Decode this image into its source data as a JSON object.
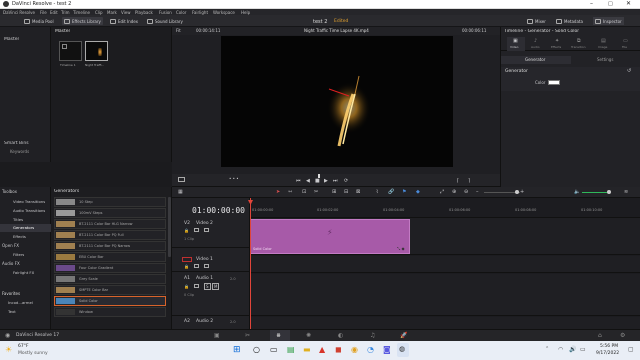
{
  "window": {
    "title": "DaVinci Resolve - test 2"
  },
  "menu": [
    "DaVinci Resolve",
    "File",
    "Edit",
    "Trim",
    "Timeline",
    "Clip",
    "Mark",
    "View",
    "Playback",
    "Fusion",
    "Color",
    "Fairlight",
    "Workspace",
    "Help"
  ],
  "toolbar": {
    "media_pool": "Media Pool",
    "effects_library": "Effects Library",
    "edit_index": "Edit Index",
    "sound_library": "Sound Library",
    "project_name": "test 2",
    "project_status": "Edited",
    "mixer": "Mixer",
    "metadata": "Metadata",
    "inspector": "Inspector"
  },
  "media_pool": {
    "sidebar": {
      "master": "Master",
      "smart_bins": "Smart Bins",
      "keywords": "Keywords"
    },
    "bin_title": "Master",
    "clips": [
      "Timeline 1",
      "Night Traffi..."
    ]
  },
  "viewer": {
    "zoom": "Fit",
    "timecode_left": "00:00:14:11",
    "clip_name": "Night Traffic Time Lapse 4K.mp4",
    "timecode_right": "00:00:06:11"
  },
  "inspector": {
    "title": "Timeline - Generator - Solid Color",
    "tabs": [
      "Video",
      "Audio",
      "Effects",
      "Transition",
      "Image",
      "File"
    ],
    "subtabs": [
      "Generator",
      "Settings"
    ],
    "section": "Generator",
    "color_label": "Color",
    "color_value": "#ffffff"
  },
  "effects": {
    "toolbox": "Toolbox",
    "items": [
      "Video Transitions",
      "Audio Transitions",
      "Titles",
      "Generators",
      "Effects"
    ],
    "open_fx": "Open FX",
    "open_fx_items": [
      "Filters"
    ],
    "audio_fx": "Audio FX",
    "audio_fx_items": [
      "Fairlight FX"
    ],
    "favorites": "Favorites",
    "favorites_items": [
      "Incod...armel",
      "Text"
    ],
    "list_title": "Generators",
    "generators": [
      {
        "name": "10 Step",
        "color": "#888"
      },
      {
        "name": "100mV Steps",
        "color": "#999"
      },
      {
        "name": "BT.2111 Color Bar HLG Narrow",
        "color": "#a08050"
      },
      {
        "name": "BT.2111 Color Bar PQ Full",
        "color": "#a08050"
      },
      {
        "name": "BT.2111 Color Bar PQ Narrow",
        "color": "#a08050"
      },
      {
        "name": "EBU Color Bar",
        "color": "#9a7a40"
      },
      {
        "name": "Four Color Gradient",
        "color": "#6a4a8a"
      },
      {
        "name": "Grey Scale",
        "color": "#777"
      },
      {
        "name": "SMPTE Color Bar",
        "color": "#a08050"
      },
      {
        "name": "Solid Color",
        "color": "#4a84b8"
      },
      {
        "name": "Window",
        "color": "#333"
      }
    ]
  },
  "timeline": {
    "timecode": "01:00:00:00",
    "ruler": [
      "01:00:00:00",
      "01:00:02:00",
      "01:00:04:00",
      "01:00:06:00",
      "01:00:08:00",
      "01:00:10:00"
    ],
    "tracks": [
      {
        "id": "V2",
        "name": "Video 2",
        "clips": "1 Clip"
      },
      {
        "id": "V1",
        "name": "Video 1",
        "clips": ""
      },
      {
        "id": "A1",
        "name": "Audio 1",
        "level": "2.0",
        "clips": "0 Clip"
      },
      {
        "id": "A2",
        "name": "Audio 2",
        "level": "2.0",
        "clips": ""
      }
    ],
    "clip_label": "Solid Color"
  },
  "pagebar": {
    "app": "DaVinci Resolve 17"
  },
  "taskbar": {
    "weather_temp": "67°F",
    "weather_desc": "Mostly sunny",
    "time": "5:56 PM",
    "date": "9/17/2022"
  }
}
